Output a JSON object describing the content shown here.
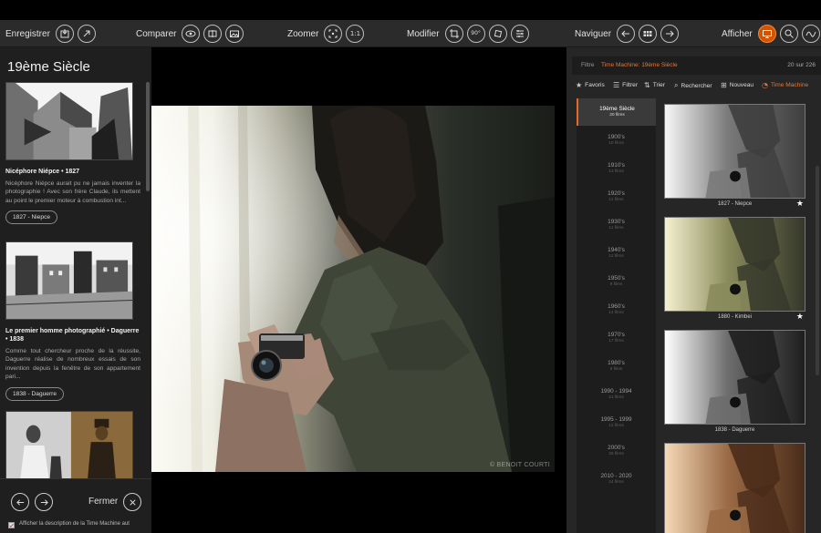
{
  "toolbar": {
    "groups": [
      {
        "label": "Enregistrer",
        "buttons": [
          "save-image-icon",
          "save-export-icon"
        ]
      },
      {
        "label": "Comparer",
        "buttons": [
          "eye-icon",
          "compare-split-icon",
          "compare-images-icon"
        ]
      },
      {
        "label": "Zoomer",
        "buttons": [
          "zoom-fit-icon"
        ],
        "zoom_text": "1:1"
      },
      {
        "label": "Modifier",
        "buttons": [
          "crop-icon",
          "rotate-90-icon",
          "straighten-icon",
          "adjust-sliders-icon"
        ],
        "rotate_text": "90°"
      },
      {
        "label": "Naviguer",
        "buttons": [
          "arrow-left-icon",
          "grid-icon",
          "arrow-right-icon"
        ]
      },
      {
        "label": "Afficher",
        "buttons": [
          "display-screen-icon",
          "magnify-icon",
          "histogram-icon"
        ]
      }
    ],
    "active_color": "#d35400"
  },
  "left_panel": {
    "title": "19ème Siècle",
    "stories": [
      {
        "title": "Nicéphore Niépce • 1827",
        "description": "Nicéphore Niépce aurait pu ne jamais inventer la photographie ! Avec son frère Claude, ils mettent au point le premier moteur à combustion int...",
        "tag": "1827 - Niepce"
      },
      {
        "title": "Le premier homme photographié • Daguerre • 1838",
        "description": "Comme tout chercheur proche de la réussite, Daguerre réalise de nombreux essais de son invention depuis la fenêtre de son appartement pari...",
        "tag": "1838 - Daguerre"
      }
    ],
    "close_label": "Fermer",
    "show_description_label": "Afficher la description de la Time Machine aut",
    "show_description_checked": true
  },
  "main_photo": {
    "watermark": "© BENOIT COURTI"
  },
  "right_panel": {
    "filter_prefix": "Filtre",
    "filter_value": "Time Machine: 19ème Siècle",
    "count": "20 sur 226",
    "tools": [
      {
        "label": "Favoris",
        "icon": "star-icon"
      },
      {
        "label": "Filtrer",
        "icon": "list-icon"
      },
      {
        "label": "Trier",
        "icon": "sort-icon"
      },
      {
        "label": "Rechercher",
        "icon": "search-icon"
      },
      {
        "label": "Nouveau",
        "icon": "new-icon"
      },
      {
        "label": "Time Machine",
        "icon": "time-machine-icon",
        "active": true
      }
    ],
    "accent_color": "#e6773a",
    "decades": [
      {
        "name": "19ème Siècle",
        "count": "20 films",
        "active": true
      },
      {
        "name": "1900's",
        "count": "10 films"
      },
      {
        "name": "1910's",
        "count": "13 films"
      },
      {
        "name": "1920's",
        "count": "11 films"
      },
      {
        "name": "1930's",
        "count": "11 films"
      },
      {
        "name": "1940's",
        "count": "12 films"
      },
      {
        "name": "1950's",
        "count": "9 films"
      },
      {
        "name": "1960's",
        "count": "14 films"
      },
      {
        "name": "1970's",
        "count": "17 films"
      },
      {
        "name": "1980's",
        "count": "8 films"
      },
      {
        "name": "1990 - 1994",
        "count": "21 films"
      },
      {
        "name": "1995 - 1999",
        "count": "12 films"
      },
      {
        "name": "2000's",
        "count": "25 films"
      },
      {
        "name": "2010 - 2020",
        "count": "24 films"
      }
    ],
    "films": [
      {
        "caption": "1827 - Niepce",
        "favorite": true
      },
      {
        "caption": "1880 - Kimbei",
        "favorite": true
      },
      {
        "caption": "1838 - Daguerre",
        "favorite": false
      },
      {
        "caption": "",
        "favorite": false
      }
    ]
  }
}
